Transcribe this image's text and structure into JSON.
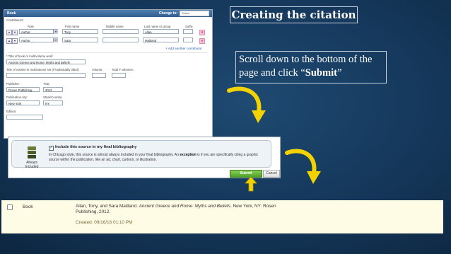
{
  "slide": {
    "title": "Creating the citation",
    "instruction_pre": "Scroll down to the bottom of the page and click “",
    "instruction_bold": "Submit",
    "instruction_post": "”"
  },
  "form": {
    "source_type": "Book",
    "change_to_label": "Change to:",
    "change_to_value": "Select",
    "contributors_label": "Contributors:",
    "columns": {
      "role": "Role",
      "first": "First name",
      "middle": "Middle name",
      "last": "Last name or group",
      "suffix": "Suffix"
    },
    "contributors": [
      {
        "role": "Author",
        "first": "Tony",
        "middle": "",
        "last": "Allan",
        "suffix": ""
      },
      {
        "role": "Author",
        "first": "Sara",
        "middle": "",
        "last": "Maitland",
        "suffix": ""
      }
    ],
    "add_contributor": "+ Add another contributor",
    "title_label": "* Title of book or multivolume work:",
    "title_value": "Ancient Greece and Rome: Myths and Beliefs",
    "volume_title_label": "Title of volume in multivolume set (if individually titled):",
    "volume_label": "Volume:",
    "total_volumes_label": "Total # volumes:",
    "publisher_label": "Publisher:",
    "publisher_value": "Rosen Publishing",
    "year_label": "Year:",
    "year_value": "2012",
    "city_label": "Publication city:",
    "city_value": "New York",
    "state_label": "State/Country:",
    "state_value": "NY",
    "edition_label": "Edition:"
  },
  "include_panel": {
    "always_label_1": "Always",
    "always_label_2": "Included",
    "checkbox_label": "Include this source in my final bibliography",
    "desc_1": "In Chicago style, this source is almost always included in your final bibliography. An ",
    "desc_bold": "exception",
    "desc_2": " is if you are specifically citing a graphic source within the publication, like an ad, chart, cartoon, or illustration.",
    "submit_label": "Submit",
    "cancel_label": "Cancel"
  },
  "citation": {
    "type": "Book",
    "authors": "Allan, Tony, and Sara Maitland. ",
    "title": "Ancient Greece and Rome: Myths and Beliefs",
    "rest": ". New York, NY: Rosen Publishing, 2012.",
    "created": "Created: 09/16/16 01:10 PM"
  },
  "colors": {
    "background": "#163a5e",
    "arrow": "#f2d300",
    "submit": "#4ea22a",
    "citation_bg": "#fffce6"
  }
}
